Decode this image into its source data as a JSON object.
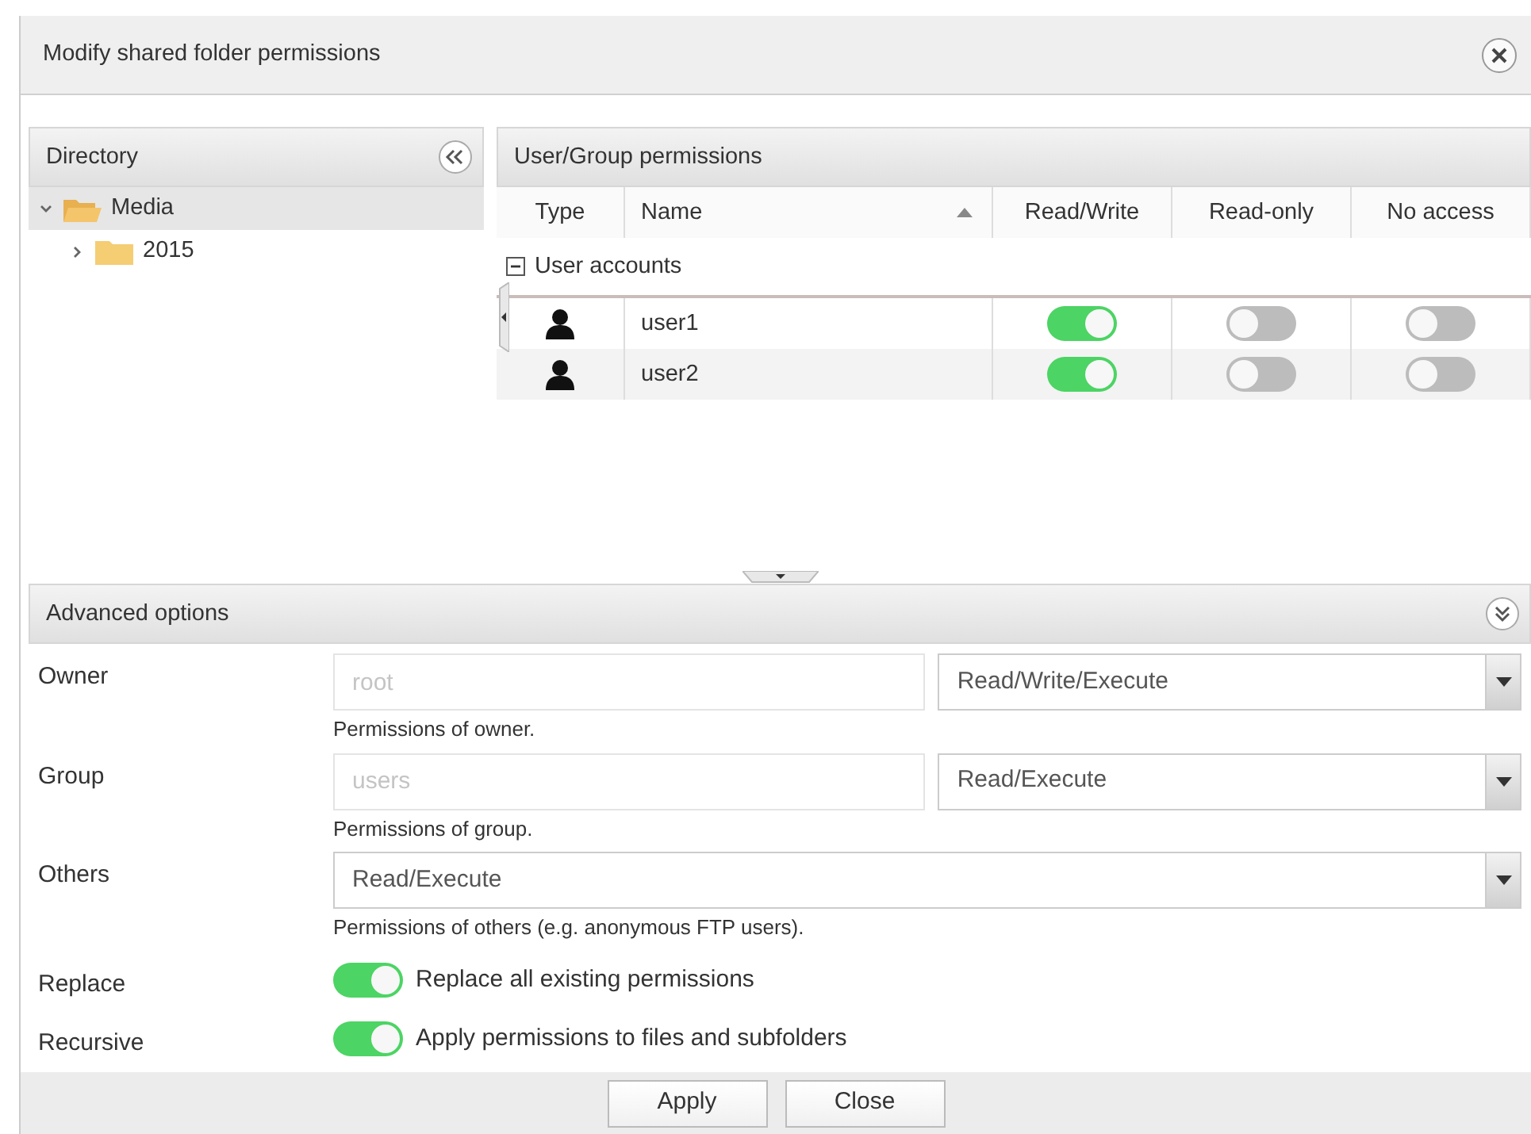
{
  "window": {
    "title": "Modify shared folder permissions"
  },
  "directory": {
    "title": "Directory",
    "tree": [
      {
        "label": "Media",
        "expanded": true,
        "selected": true,
        "children": [
          {
            "label": "2015",
            "expanded": false,
            "selected": false
          }
        ]
      }
    ]
  },
  "permissions": {
    "title": "User/Group permissions",
    "columns": [
      {
        "label": "Type",
        "sorted": false
      },
      {
        "label": "Name",
        "sorted": true
      },
      {
        "label": "Read/Write",
        "sorted": false
      },
      {
        "label": "Read-only",
        "sorted": false
      },
      {
        "label": "No access",
        "sorted": false
      }
    ],
    "groups": [
      {
        "label": "User accounts",
        "expanded": true,
        "rows": [
          {
            "name": "user1",
            "read_write": true,
            "read_only": false,
            "no_access": false
          },
          {
            "name": "user2",
            "read_write": true,
            "read_only": false,
            "no_access": false
          }
        ]
      }
    ]
  },
  "advanced": {
    "title": "Advanced options",
    "fields": [
      {
        "kind": "pair",
        "label": "Owner",
        "value": "root",
        "disabled": true,
        "select": "Read/Write/Execute",
        "hint": "Permissions of owner."
      },
      {
        "kind": "pair",
        "label": "Group",
        "value": "users",
        "disabled": true,
        "select": "Read/Execute",
        "hint": "Permissions of group."
      },
      {
        "kind": "select",
        "label": "Others",
        "select": "Read/Execute",
        "hint": "Permissions of others (e.g. anonymous FTP users)."
      },
      {
        "kind": "switch",
        "label": "Replace",
        "on": true,
        "text": "Replace all existing permissions"
      },
      {
        "kind": "switch",
        "label": "Recursive",
        "on": true,
        "text": "Apply permissions to files and subfolders"
      }
    ]
  },
  "buttons": [
    "Apply",
    "Close"
  ]
}
